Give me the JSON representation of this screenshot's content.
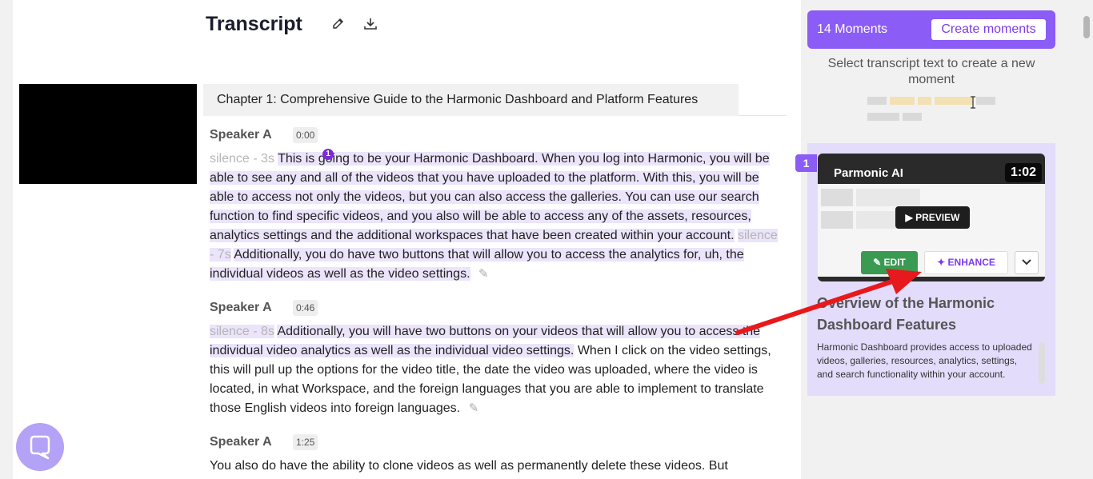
{
  "header": {
    "title": "Transcript",
    "edit_icon": "pencil-icon",
    "download_icon": "download-icon"
  },
  "chapter": {
    "title": "Chapter 1: Comprehensive Guide to the Harmonic Dashboard and Platform Features"
  },
  "segments": [
    {
      "speaker": "Speaker A",
      "time": "0:00",
      "silence1": "silence - 3s",
      "part1_pre": "This is ",
      "part1_post": "going to be your Harmonic Dashboard. When you log into Harmonic, you will be able to see any and all of the videos that you have uploaded to the platform. With this, you will be able to access not only the videos, but you can also access the galleries. You can use our search function to find specific videos, and you also will be able to access any of the assets, resources, analytics settings and the additional workspaces that have been created within your account.",
      "silence2": "silence - 7s",
      "part2": "Additionally, you do have two buttons that will allow you to access the analytics for, uh, the individual videos as well as the video settings."
    },
    {
      "speaker": "Speaker A",
      "time": "0:46",
      "silence1": "silence - 8s",
      "part1": "Additionally, you will have two buttons on your videos that will allow you to access the individual video analytics as well as the individual video settings.",
      "part2": "When I click on the video settings, this will pull up the options for the video title, the date the video was uploaded, where the video is located, in what Workspace, and the foreign languages that you are able to implement to translate those English videos into foreign languages."
    },
    {
      "speaker": "Speaker A",
      "time": "1:25",
      "text": "You also do have the ability to clone videos as well as permanently delete these videos. But"
    }
  ],
  "moment_marker": "1",
  "moments": {
    "count_label": "14 Moments",
    "create_label": "Create moments",
    "hint": "Select transcript text to create a new moment",
    "card": {
      "number": "1",
      "thumb_title": "Parmonic AI",
      "duration": "1:02",
      "preview_label": "PREVIEW",
      "edit_label": "EDIT",
      "enhance_label": "ENHANCE",
      "title": "Overview of the Harmonic Dashboard Features",
      "description": "Harmonic Dashboard provides access to uploaded videos, galleries, resources, analytics, settings, and search functionality within your account."
    }
  },
  "colors": {
    "accent": "#8b5cf6",
    "highlight": "#ebe4fb",
    "edit_green": "#3a9a52",
    "arrow_red": "#e8191c"
  }
}
